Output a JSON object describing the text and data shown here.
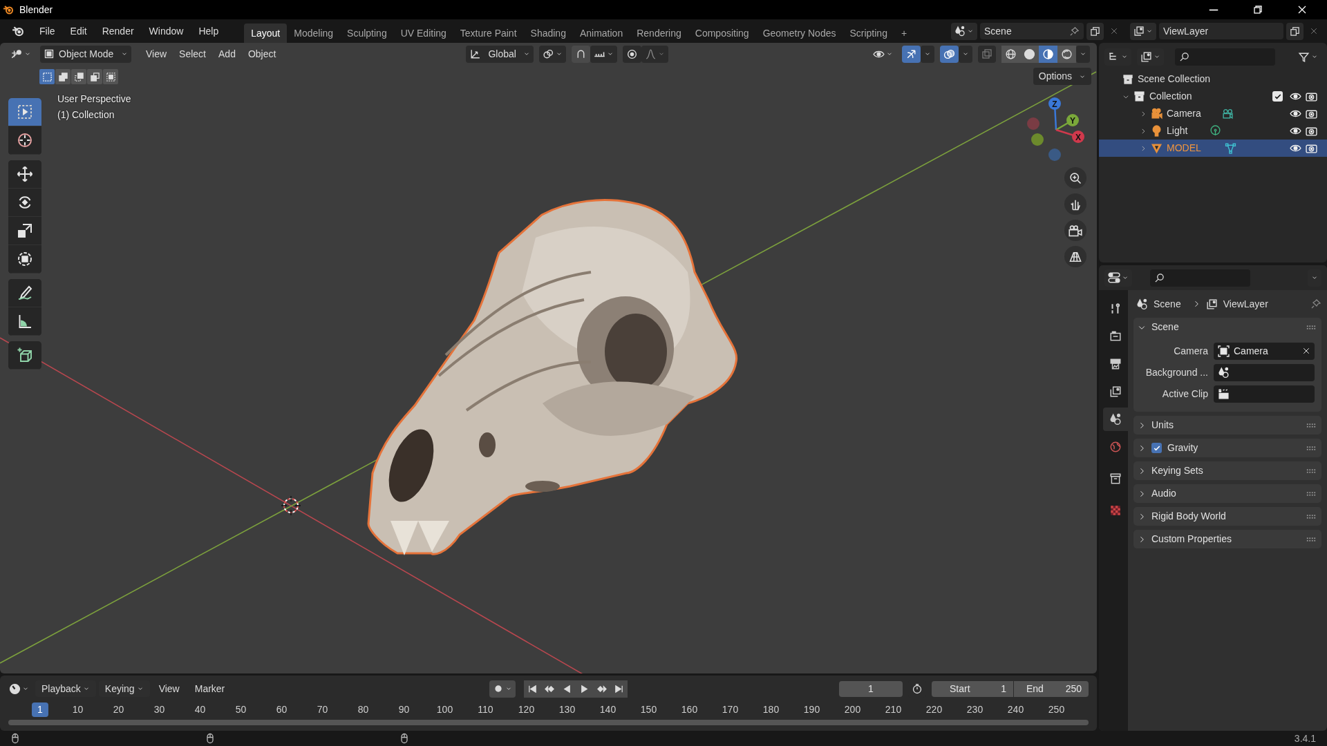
{
  "window": {
    "title": "Blender"
  },
  "menus": [
    "File",
    "Edit",
    "Render",
    "Window",
    "Help"
  ],
  "workspaces": [
    {
      "label": "Layout",
      "selected": true
    },
    {
      "label": "Modeling",
      "selected": false
    },
    {
      "label": "Sculpting",
      "selected": false
    },
    {
      "label": "UV Editing",
      "selected": false
    },
    {
      "label": "Texture Paint",
      "selected": false
    },
    {
      "label": "Shading",
      "selected": false
    },
    {
      "label": "Animation",
      "selected": false
    },
    {
      "label": "Rendering",
      "selected": false
    },
    {
      "label": "Compositing",
      "selected": false
    },
    {
      "label": "Geometry Nodes",
      "selected": false
    },
    {
      "label": "Scripting",
      "selected": false
    }
  ],
  "add_workspace": "+",
  "scene": "Scene",
  "view_layer": "ViewLayer",
  "viewport": {
    "mode": "Object Mode",
    "menus": [
      "View",
      "Select",
      "Add",
      "Object"
    ],
    "orientation": "Global",
    "options": "Options",
    "select_modes": [
      {
        "selected": true
      },
      {
        "selected": false
      },
      {
        "selected": false
      },
      {
        "selected": false
      },
      {
        "selected": false
      }
    ],
    "gizmos": true,
    "overlays": true,
    "shading": [
      {
        "selected": false
      },
      {
        "selected": false
      },
      {
        "selected": true
      },
      {
        "selected": false
      }
    ],
    "info": [
      "User Perspective",
      "(1) Collection"
    ],
    "tool_groups": [
      [
        {
          "kind": "select",
          "selected": true
        },
        {
          "kind": "cursor",
          "selected": false
        }
      ],
      [
        {
          "kind": "move",
          "selected": false
        },
        {
          "kind": "rotate",
          "selected": false
        },
        {
          "kind": "scale",
          "selected": false
        },
        {
          "kind": "transform",
          "selected": false
        }
      ],
      [
        {
          "kind": "annotate",
          "selected": false
        },
        {
          "kind": "measure",
          "selected": false
        }
      ],
      [
        {
          "kind": "add_cube",
          "selected": false
        }
      ]
    ],
    "axes": [
      "Z",
      "Y",
      "X"
    ]
  },
  "outliner": {
    "root": "Scene Collection",
    "items": [
      {
        "label": "Collection",
        "kind": "collection",
        "expanded": true,
        "checked": true,
        "selected": false,
        "children": [
          {
            "label": "Camera",
            "kind": "camera",
            "expanded": false,
            "selected": false
          },
          {
            "label": "Light",
            "kind": "light",
            "expanded": false,
            "selected": false
          },
          {
            "label": "MODEL",
            "kind": "mesh",
            "expanded": false,
            "selected": true
          }
        ]
      }
    ]
  },
  "properties": {
    "tabs": [
      {
        "kind": "tool",
        "selected": false
      },
      {
        "kind": "render",
        "selected": false
      },
      {
        "kind": "output",
        "selected": false
      },
      {
        "kind": "view_layer",
        "selected": false
      },
      {
        "kind": "scene",
        "selected": true
      },
      {
        "kind": "world",
        "selected": false
      },
      {
        "kind": "collection",
        "selected": false
      },
      {
        "kind": "texture",
        "selected": false
      }
    ],
    "breadcrumb": [
      "Scene",
      "ViewLayer"
    ],
    "panels": [
      {
        "title": "Scene",
        "expanded": true,
        "fields": [
          {
            "label": "Camera",
            "kind": "object",
            "value": "Camera"
          },
          {
            "label": "Background ...",
            "kind": "scene"
          },
          {
            "label": "Active Clip",
            "kind": "clip"
          }
        ]
      },
      {
        "title": "Units",
        "expanded": false
      },
      {
        "title": "Gravity",
        "expanded": false,
        "checked": true
      },
      {
        "title": "Keying Sets",
        "expanded": false
      },
      {
        "title": "Audio",
        "expanded": false
      },
      {
        "title": "Rigid Body World",
        "expanded": false
      },
      {
        "title": "Custom Properties",
        "expanded": false
      }
    ]
  },
  "timeline": {
    "menus": [
      {
        "label": "Playback",
        "dropdown": true
      },
      {
        "label": "Keying",
        "dropdown": true
      },
      {
        "label": "View",
        "dropdown": false
      },
      {
        "label": "Marker",
        "dropdown": false
      }
    ],
    "frame": "1",
    "start_label": "Start",
    "start": "1",
    "end_label": "End",
    "end": "250",
    "playhead": "1",
    "ticks": [
      "10",
      "20",
      "30",
      "40",
      "50",
      "60",
      "70",
      "80",
      "90",
      "100",
      "110",
      "120",
      "130",
      "140",
      "150",
      "160",
      "170",
      "180",
      "190",
      "200",
      "210",
      "220",
      "230",
      "240",
      "250"
    ]
  },
  "status_bar": {
    "version": "3.4.1"
  }
}
